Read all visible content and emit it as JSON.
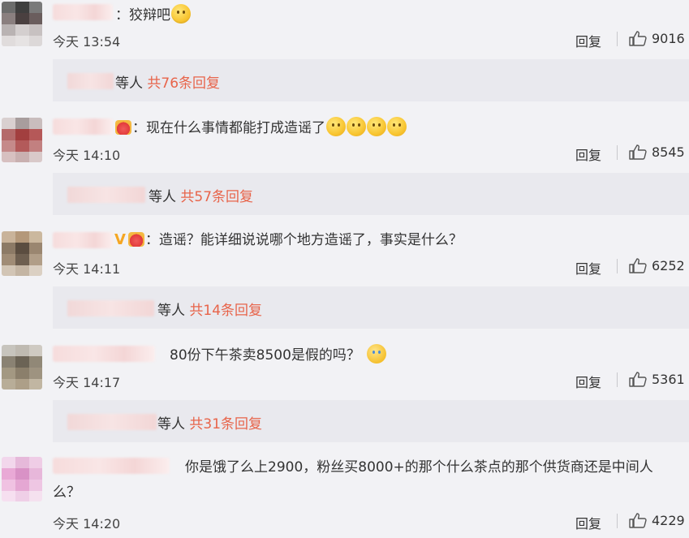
{
  "comments": [
    {
      "text": "：狡辩吧",
      "time": "今天 13:54",
      "reply": "回复",
      "likes": "9016",
      "sub": {
        "prefix": "等人",
        "count": "共76条回复"
      }
    },
    {
      "text": "：现在什么事情都能打成造谣了",
      "time": "今天 14:10",
      "reply": "回复",
      "likes": "8545",
      "sub": {
        "prefix": "等人",
        "count": "共57条回复"
      }
    },
    {
      "badge": "V",
      "text": "：造谣？能详细说说哪个地方造谣了，事实是什么？",
      "time": "今天 14:11",
      "reply": "回复",
      "likes": "6252",
      "sub": {
        "prefix": "等人",
        "count": "共14条回复"
      }
    },
    {
      "text": "80份下午茶卖8500是假的吗？",
      "time": "今天 14:17",
      "reply": "回复",
      "likes": "5361",
      "sub": {
        "prefix": "等人",
        "count": "共31条回复"
      }
    },
    {
      "text_line1": "你是饿了么上2900，粉丝买8000+的那个什么茶点的那个供货商还是中间人",
      "text_line2": "么？",
      "time": "今天 14:20",
      "reply": "回复",
      "likes": "4229"
    }
  ]
}
